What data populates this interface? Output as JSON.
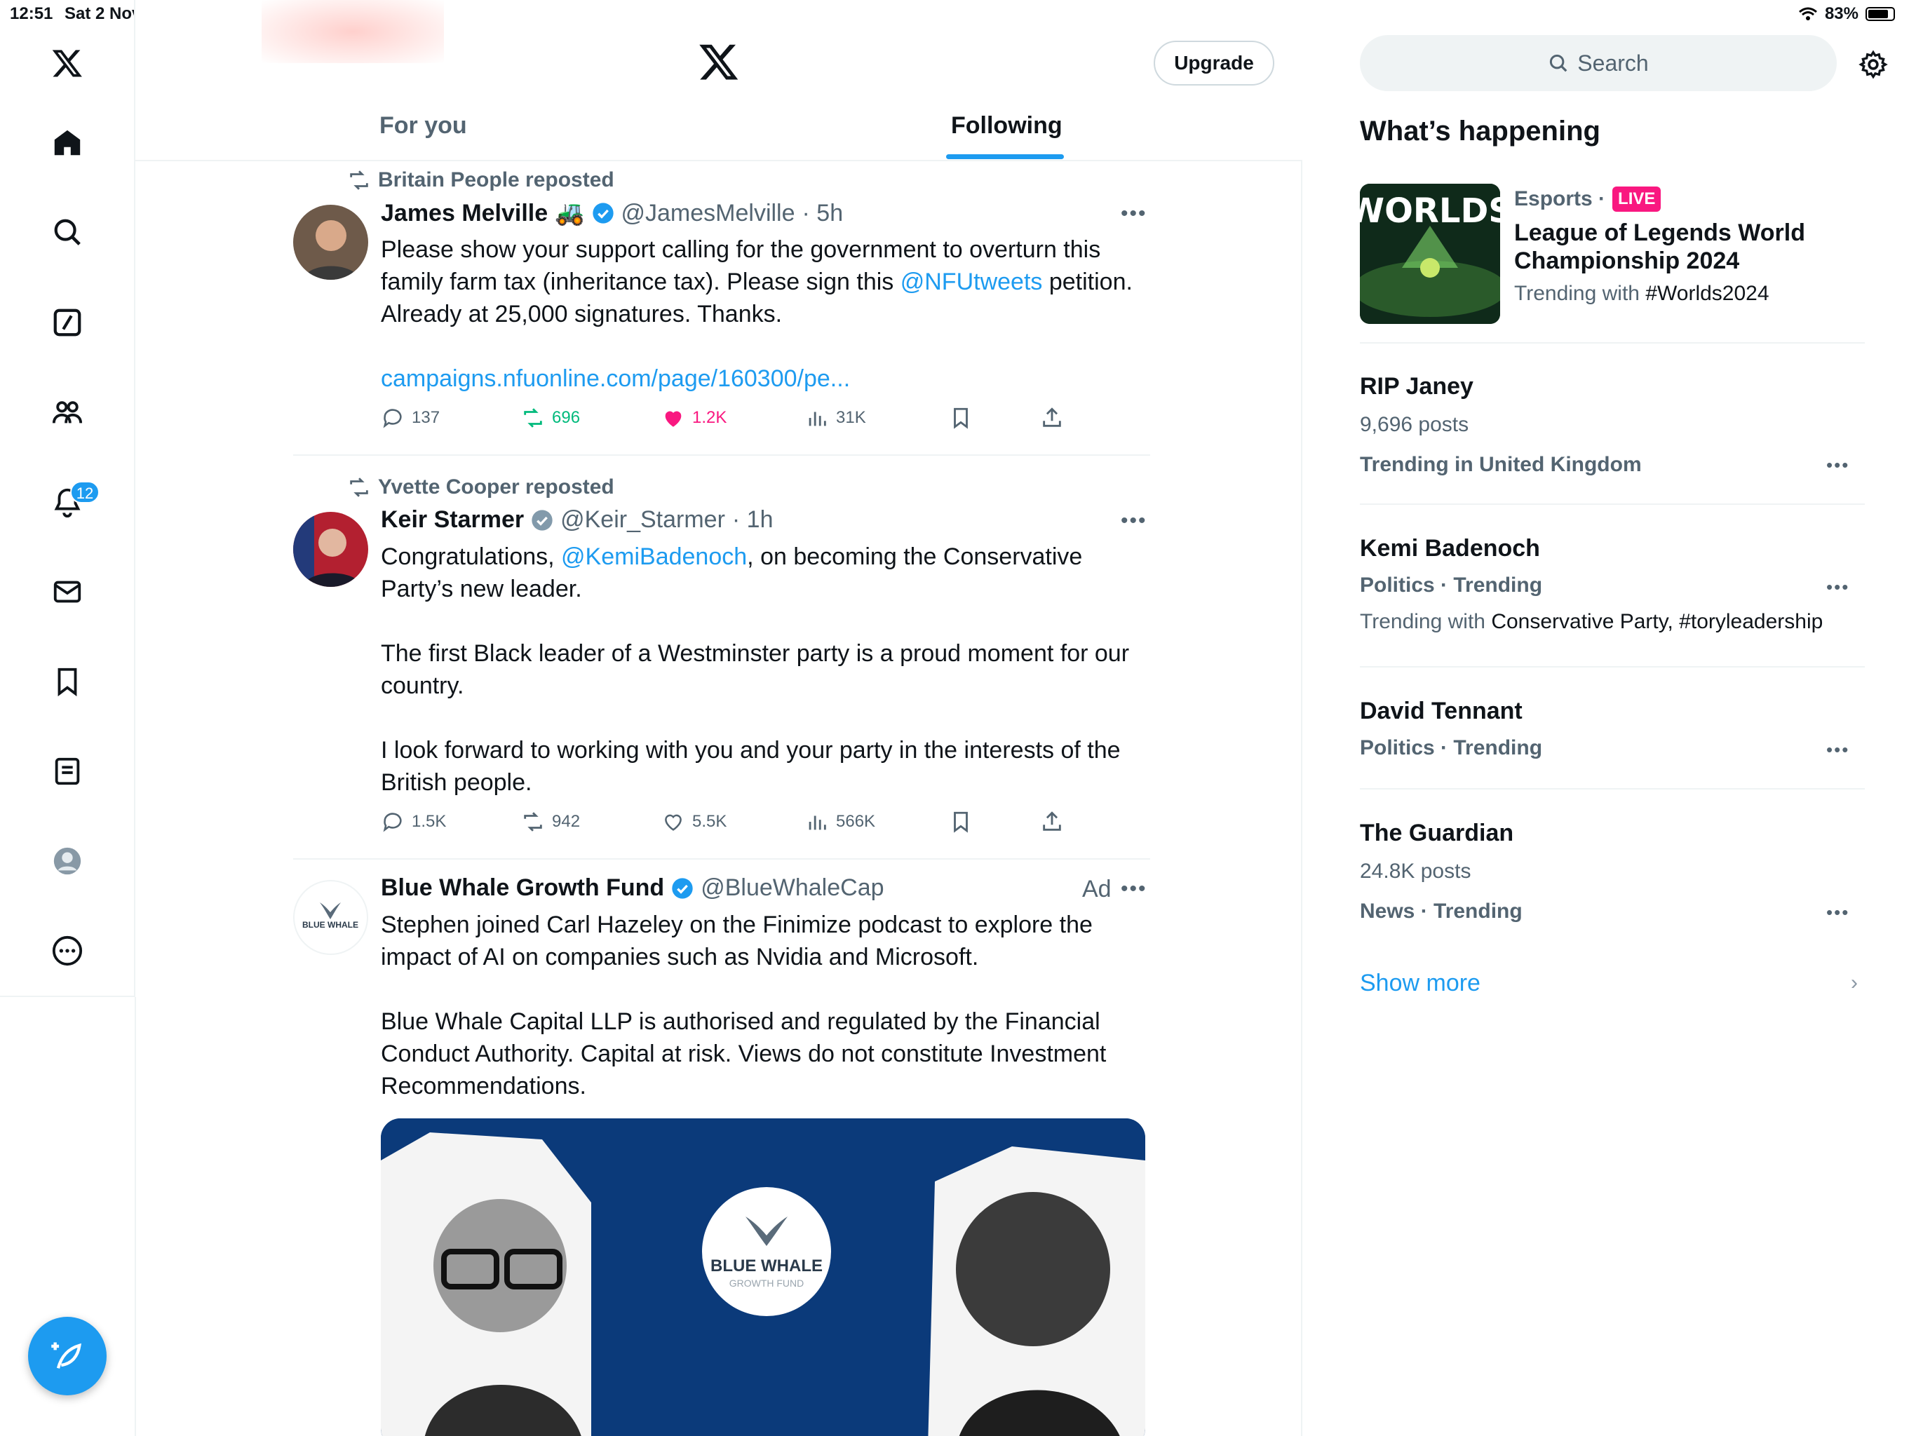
{
  "status_bar": {
    "time": "12:51",
    "date": "Sat 2 Nov",
    "battery": "83%"
  },
  "header": {
    "upgrade_label": "Upgrade",
    "tabs": [
      {
        "label": "For you"
      },
      {
        "label": "Following"
      }
    ]
  },
  "nav": {
    "notifications_count": "12"
  },
  "tweets": [
    {
      "repost_by": "Britain People reposted",
      "name": "James Melville",
      "name_emoji": "🚜",
      "handle": "@JamesMelville",
      "time": "· 5h",
      "text1a": "Please show your support calling for the government to overturn this family farm tax (inheritance tax). Please sign this ",
      "mention": "@NFUtweets",
      "text1b": " petition. Already at 25,000 signatures. Thanks.",
      "link": "campaigns.nfuonline.com/page/160300/pe...",
      "replies": "137",
      "reposts": "696",
      "likes": "1.2K",
      "views": "31K"
    },
    {
      "repost_by": "Yvette Cooper reposted",
      "name": "Keir Starmer",
      "handle": "@Keir_Starmer",
      "time": "· 1h",
      "text1a": "Congratulations, ",
      "mention": "@KemiBadenoch",
      "text1b": ", on becoming the Conservative Party’s new leader.",
      "text2": "The first Black leader of a Westminster party is a proud moment for our country.",
      "text3": "I look forward to working with you and your party in the interests of the British people.",
      "replies": "1.5K",
      "reposts": "942",
      "likes": "5.5K",
      "views": "566K"
    },
    {
      "name": "Blue Whale Growth Fund",
      "handle": "@BlueWhaleCap",
      "ad_label": "Ad",
      "avatar_text": "BLUE WHALE",
      "text1": "Stephen joined Carl Hazeley on the Finimize podcast to explore the impact of AI on companies such as Nvidia and Microsoft.",
      "text2": "Blue Whale Capital LLP is authorised and regulated by the Financial Conduct Authority. Capital at risk. Views do not constitute Investment Recommendations.",
      "media_logo_main": "BLUE WHALE",
      "media_logo_sub": "GROWTH FUND"
    }
  ],
  "sidebar": {
    "search_placeholder": "Search",
    "title": "What’s happening",
    "trends": [
      {
        "meta": "Esports ·",
        "live": "LIVE",
        "title": "League of Legends World Championship 2024",
        "sub_prefix": "Trending with ",
        "sub_value": "#Worlds2024",
        "thumb_text": "WORLDS"
      },
      {
        "title": "RIP Janey",
        "posts": "9,696 posts",
        "meta": "Trending in United Kingdom"
      },
      {
        "title": "Kemi Badenoch",
        "meta": "Politics · Trending",
        "sub_prefix": "Trending with ",
        "sub_value": "Conservative Party, #toryleadership"
      },
      {
        "title": "David Tennant",
        "meta": "Politics · Trending"
      },
      {
        "title": "The Guardian",
        "posts": "24.8K posts",
        "meta": "News · Trending"
      }
    ],
    "show_more": "Show more"
  },
  "colors": {
    "accent": "#1d9bf0",
    "like": "#f91880",
    "repost": "#00ba7c",
    "muted": "#536471"
  }
}
